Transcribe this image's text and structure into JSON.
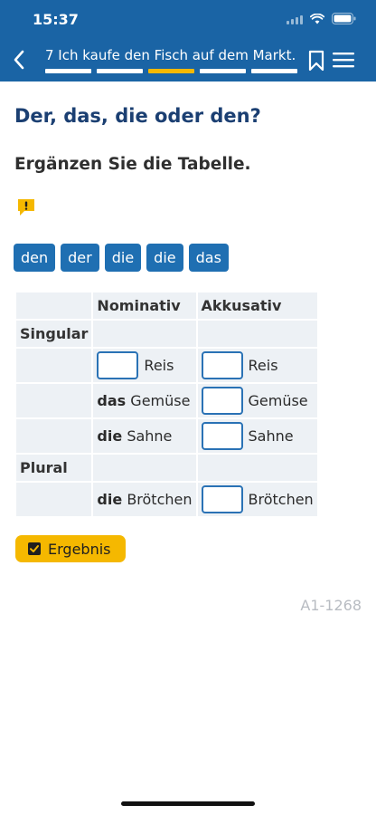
{
  "status_bar": {
    "time": "15:37"
  },
  "nav": {
    "title": "7 Ich kaufe den Fisch auf dem Markt.",
    "progress_total": 5,
    "progress_active_index": 2
  },
  "exercise": {
    "title": "Der, das, die oder den?",
    "instruction": "Ergänzen Sie die Tabelle."
  },
  "word_bank": [
    "den",
    "der",
    "die",
    "die",
    "das"
  ],
  "table": {
    "headers": [
      "",
      "Nominativ",
      "Akkusativ"
    ],
    "singular_label": "Singular",
    "plural_label": "Plural",
    "singular_rows": [
      {
        "nom_article": "",
        "nom_noun": "Reis",
        "akk_noun": "Reis"
      },
      {
        "nom_article": "das",
        "nom_noun": "Gemüse",
        "akk_noun": "Gemüse"
      },
      {
        "nom_article": "die",
        "nom_noun": "Sahne",
        "akk_noun": "Sahne"
      }
    ],
    "plural_rows": [
      {
        "nom_article": "die",
        "nom_noun": "Brötchen",
        "akk_noun": "Brötchen"
      }
    ]
  },
  "result_button": {
    "label": "Ergebnis"
  },
  "exercise_code": "A1-1268",
  "colors": {
    "header_blue": "#1a64a5",
    "chip_blue": "#1f6fb2",
    "accent_yellow": "#f5b800",
    "title_blue": "#1b3f72"
  }
}
